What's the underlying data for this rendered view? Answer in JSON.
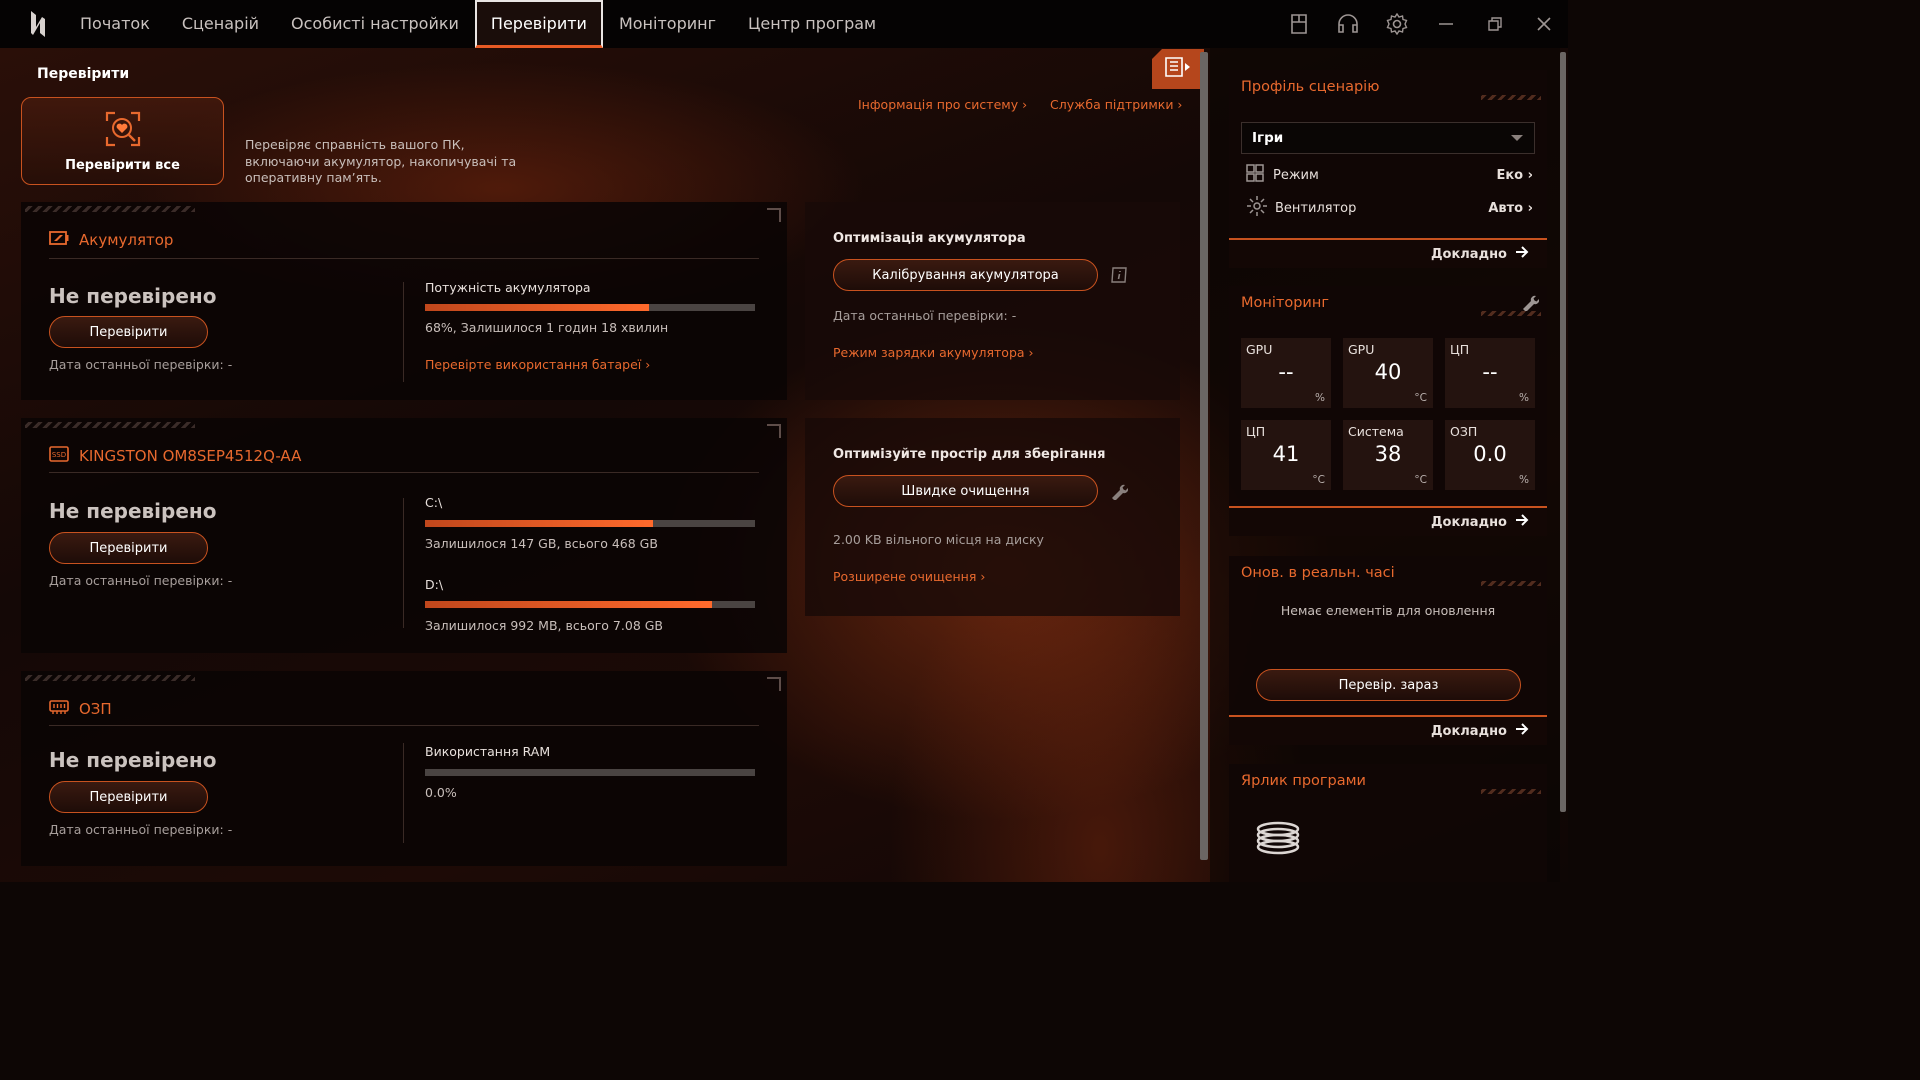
{
  "nav": {
    "items": [
      "Початок",
      "Сценарій",
      "Особисті настройки",
      "Перевірити",
      "Моніторинг",
      "Центр програм"
    ],
    "active": "Перевірити"
  },
  "page": {
    "title": "Перевірити",
    "check_all_label": "Перевірити все",
    "description": "Перевіряє справність вашого ПК, включаючи акумулятор, накопичувачі та оперативну пам’ять.",
    "system_info_link": "Інформація про систему ›",
    "support_link": "Служба підтримки ›"
  },
  "battery": {
    "title": "Акумулятор",
    "status": "Не перевірено",
    "check_button": "Перевірити",
    "last_check": "Дата останньої перевірки: -",
    "power_label": "Потужність акумулятора",
    "power_percent": 68,
    "power_text": "68%, Залишилося 1 годин 18 хвилин",
    "usage_link": "Перевірте використання батареї ›"
  },
  "battery_opt": {
    "title": "Оптимізація акумулятора",
    "calibrate_button": "Калібрування акумулятора",
    "last_check": "Дата останньої перевірки: -",
    "charge_mode_link": "Режим зарядки акумулятора ›"
  },
  "storage": {
    "title": "KINGSTON OM8SEP4512Q-AA",
    "status": "Не перевірено",
    "check_button": "Перевірити",
    "last_check": "Дата останньої перевірки: -",
    "drives": [
      {
        "label": "C:\\",
        "used_fraction": 0.69,
        "text": "Залишилося 147 GB, всього 468 GB"
      },
      {
        "label": "D:\\",
        "used_fraction": 0.87,
        "text": "Залишилося 992 MB, всього 7.08 GB"
      }
    ]
  },
  "storage_opt": {
    "title": "Оптимізуйте простір для зберігання",
    "quick_clean_button": "Швидке очищення",
    "free_space": "2.00 KB вільного місця на диску",
    "advanced_link": "Розширене очищення ›"
  },
  "ram": {
    "title": "ОЗП",
    "status": "Не перевірено",
    "check_button": "Перевірити",
    "last_check": "Дата останньої перевірки: -",
    "usage_label": "Використання RAM",
    "usage_percent": 0,
    "usage_text": "0.0%"
  },
  "sidebar": {
    "profile": {
      "title": "Профіль сценарію",
      "selected": "Ігри",
      "mode_label": "Режим",
      "mode_value": "Еко ›",
      "fan_label": "Вентилятор",
      "fan_value": "Авто ›",
      "more": "Докладно"
    },
    "monitoring": {
      "title": "Моніторинг",
      "tiles": [
        {
          "label": "GPU",
          "value": "--",
          "unit": "%"
        },
        {
          "label": "GPU",
          "value": "40",
          "unit": "°C"
        },
        {
          "label": "ЦП",
          "value": "--",
          "unit": "%"
        },
        {
          "label": "ЦП",
          "value": "41",
          "unit": "°C"
        },
        {
          "label": "Система",
          "value": "38",
          "unit": "°C"
        },
        {
          "label": "ОЗП",
          "value": "0.0",
          "unit": "%"
        }
      ],
      "more": "Докладно"
    },
    "updates": {
      "title": "Онов. в реальн. часі",
      "empty_text": "Немає елементів для оновлення",
      "check_now_button": "Перевір. зараз",
      "more": "Докладно"
    },
    "shortcut": {
      "title": "Ярлик програми"
    }
  },
  "colors": {
    "accent": "#e8692e",
    "border_accent": "#c8521f",
    "bar_track": "#4a4442"
  }
}
